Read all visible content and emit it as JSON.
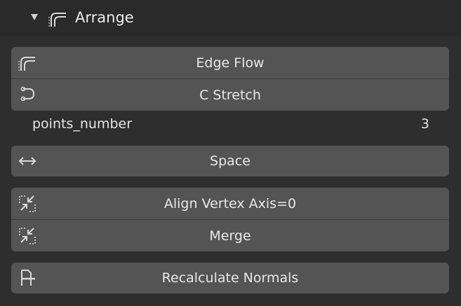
{
  "panel": {
    "title": "Arrange",
    "title_icon": "edge-flow-icon"
  },
  "buttons": {
    "edge_flow": {
      "label": "Edge Flow",
      "icon": "edge-flow-icon"
    },
    "c_stretch": {
      "label": "C Stretch",
      "icon": "c-stretch-icon"
    },
    "space": {
      "label": "Space",
      "icon": "horizontal-arrows-icon"
    },
    "align_vertex": {
      "label": "Align Vertex Axis=0",
      "icon": "align-icon"
    },
    "merge": {
      "label": "Merge",
      "icon": "merge-icon"
    },
    "recalc_normals": {
      "label": "Recalculate Normals",
      "icon": "normals-icon"
    }
  },
  "points_number": {
    "label": "points_number",
    "value": "3"
  },
  "colors": {
    "button_bg": "#545454",
    "panel_bg": "#2e2e2e",
    "header_bg": "#2a2a2a",
    "text": "#e8e8e8"
  }
}
